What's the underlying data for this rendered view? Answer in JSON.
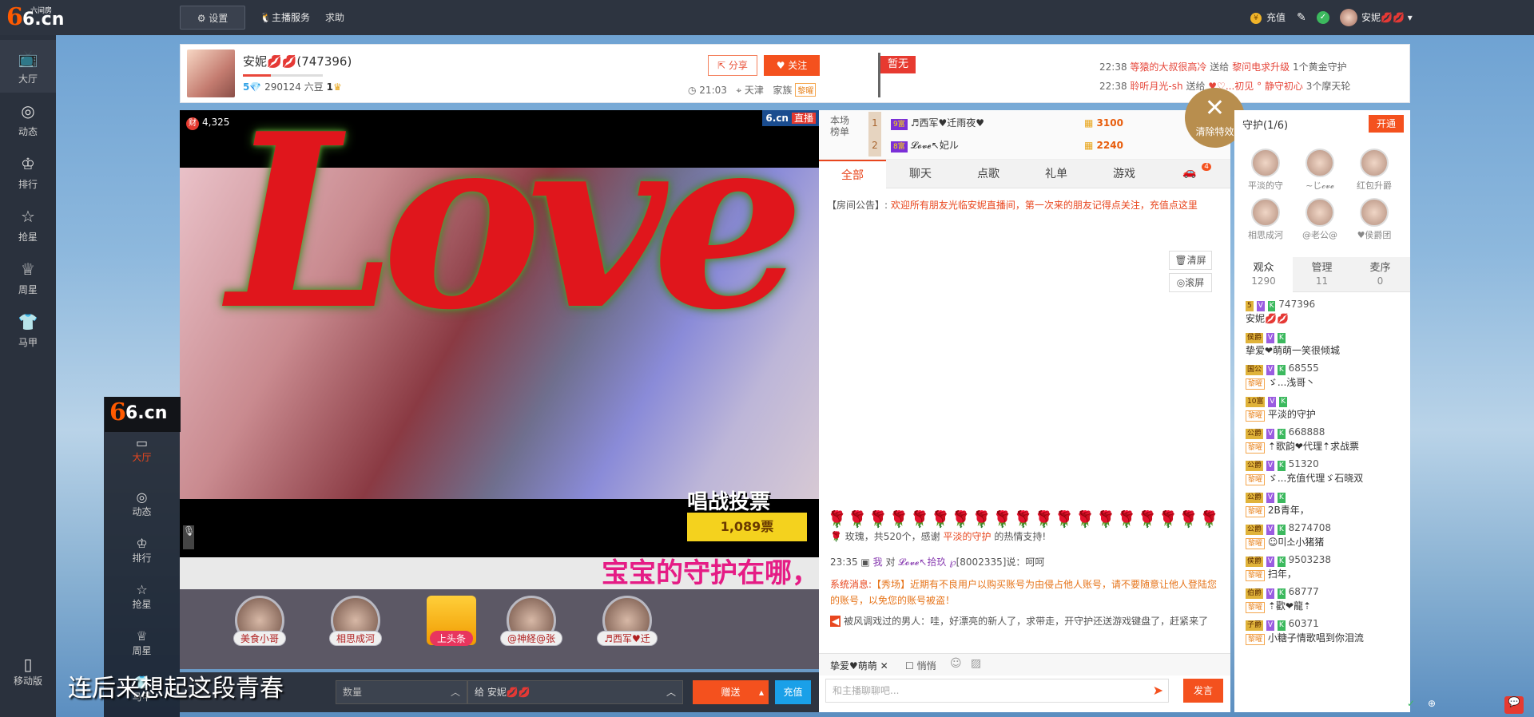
{
  "topbar": {
    "logo_main": "6.cn",
    "logo_sub": "六间房",
    "settings": "设置",
    "host_service": "主播服务",
    "help": "求助",
    "recharge": "充值",
    "user": "安妮💋💋"
  },
  "leftnav": {
    "items": [
      "大厅",
      "动态",
      "排行",
      "抢星",
      "周星",
      "马甲"
    ],
    "mobile": "移动版"
  },
  "streamer": {
    "name": "安妮💋💋(747396)",
    "level": "5",
    "beans": "290124 六豆",
    "crown": "1",
    "level_progress": 0.35,
    "share": "分享",
    "follow": "关注",
    "time": "21:03",
    "location": "天津",
    "family_label": "家族",
    "family_badge": "黎曜",
    "flag": "暂无"
  },
  "gift_feed": [
    {
      "time": "22:38",
      "from": "等猿的大叔很高冷",
      "verb": "送给",
      "to": "黎问电求升级",
      "item": "1个黄金守护"
    },
    {
      "time": "22:38",
      "from": "聆听月光-sh",
      "verb": "送给",
      "to": "♥♡...初见 ° 静守初心",
      "item": "3个摩天轮"
    }
  ],
  "video": {
    "fortune": "4,325",
    "brand": "6.cn",
    "live": "直播",
    "love_text": "Love",
    "vote_title": "唱战投票",
    "votes": "1,089票",
    "marquee": "宝宝的守护在哪，",
    "subtitle": "连后来想起这段青春"
  },
  "guard_strip": [
    {
      "label": "美食小哥"
    },
    {
      "label": "相思成河"
    },
    {
      "label": "上头条"
    },
    {
      "label": "@神経@张"
    },
    {
      "label": "♬西军♥迁"
    }
  ],
  "controls": {
    "qty_placeholder": "数量",
    "to_label": "给 安妮💋💋",
    "send": "赠送",
    "recharge": "充值",
    "ghost_logo": "6.cn",
    "ghost_items": [
      "大厅",
      "动态",
      "排行",
      "抢星",
      "周星",
      "马甲"
    ]
  },
  "chat": {
    "rank_label": "本场榜单",
    "rank": [
      {
        "no": "1",
        "badge": "9富",
        "name": "♬西军♥迁雨夜♥",
        "pts": "3100"
      },
      {
        "no": "2",
        "badge": "8富",
        "name": "𝓛𝓸𝓿𝓮↖妃ル",
        "pts": "2240"
      }
    ],
    "tabs": [
      "全部",
      "聊天",
      "点歌",
      "礼单",
      "游戏"
    ],
    "tab_badge": "4",
    "announce_label": "【房间公告】:",
    "announce_text": "欢迎所有朋友光临安妮直播间，第一次来的朋友记得点关注，充值点这里",
    "clear": "清屏",
    "scroll": "滚屏",
    "rose_msg_a": "玫瑰，共520个，感谢",
    "rose_msg_b": "平淡的守护",
    "rose_msg_c": "的热情支持!",
    "msg1_time": "23:35",
    "msg1_from": "我",
    "msg1_to_word": "对",
    "msg1_to": "𝓛𝓸𝓿𝓮↖拾玖 ℘",
    "msg1_id": "[8002335]",
    "msg1_text": "说：呵呵",
    "sys_label": "系统消息:",
    "sys_text": "【秀场】近期有不良用户以购买账号为由侵占他人账号，请不要随意让他人登陆您的账号，以免您的账号被盗！",
    "msg2": "被风调戏过的男人：哇，好漂亮的新人了，求带走，开守护还送游戏键盘了，赶紧来了",
    "chat_target": "挚爱♥萌萌",
    "whisper": "悄悄",
    "input_placeholder": "和主播聊聊吧...",
    "send_msg": "发言",
    "clear_effect": "清除特效"
  },
  "right": {
    "guard_title": "守护(1/6)",
    "open": "开通",
    "guards": [
      "平淡的守",
      "~じ𝓬𝓿𝓮",
      "红包升爵",
      "相思成河",
      "@老公@",
      "♥侯爵团"
    ],
    "aud_tabs": [
      {
        "label": "观众",
        "count": "1290"
      },
      {
        "label": "管理",
        "count": "11"
      },
      {
        "label": "麦序",
        "count": "0"
      }
    ],
    "audience": [
      {
        "lv": "5",
        "id": "747396",
        "name": "安妮💋💋"
      },
      {
        "lv": "侯爵",
        "id": "",
        "name": "挚爱❤萌萌一笑很倾城"
      },
      {
        "lv": "国公",
        "id": "68555",
        "name": "ゞ...浅哥丶"
      },
      {
        "lv": "10富",
        "id": "",
        "name": "平淡的守护"
      },
      {
        "lv": "公爵",
        "id": "668888",
        "name": "⇡歌韵❤代理⇡求战票"
      },
      {
        "lv": "公爵",
        "id": "51320",
        "name": "ゞ...充值代理ゞ石晓双"
      },
      {
        "lv": "公爵",
        "id": "",
        "name": "2B青年，"
      },
      {
        "lv": "公爵",
        "id": "8274708",
        "name": "☺미소小猪猪"
      },
      {
        "lv": "侯爵",
        "id": "9503238",
        "name": "扫年，"
      },
      {
        "lv": "伯爵",
        "id": "68777",
        "name": "⇡歡❤龍⇡"
      },
      {
        "lv": "子爵",
        "id": "60371",
        "name": "小糖子情歌唱到你泪流"
      }
    ]
  }
}
